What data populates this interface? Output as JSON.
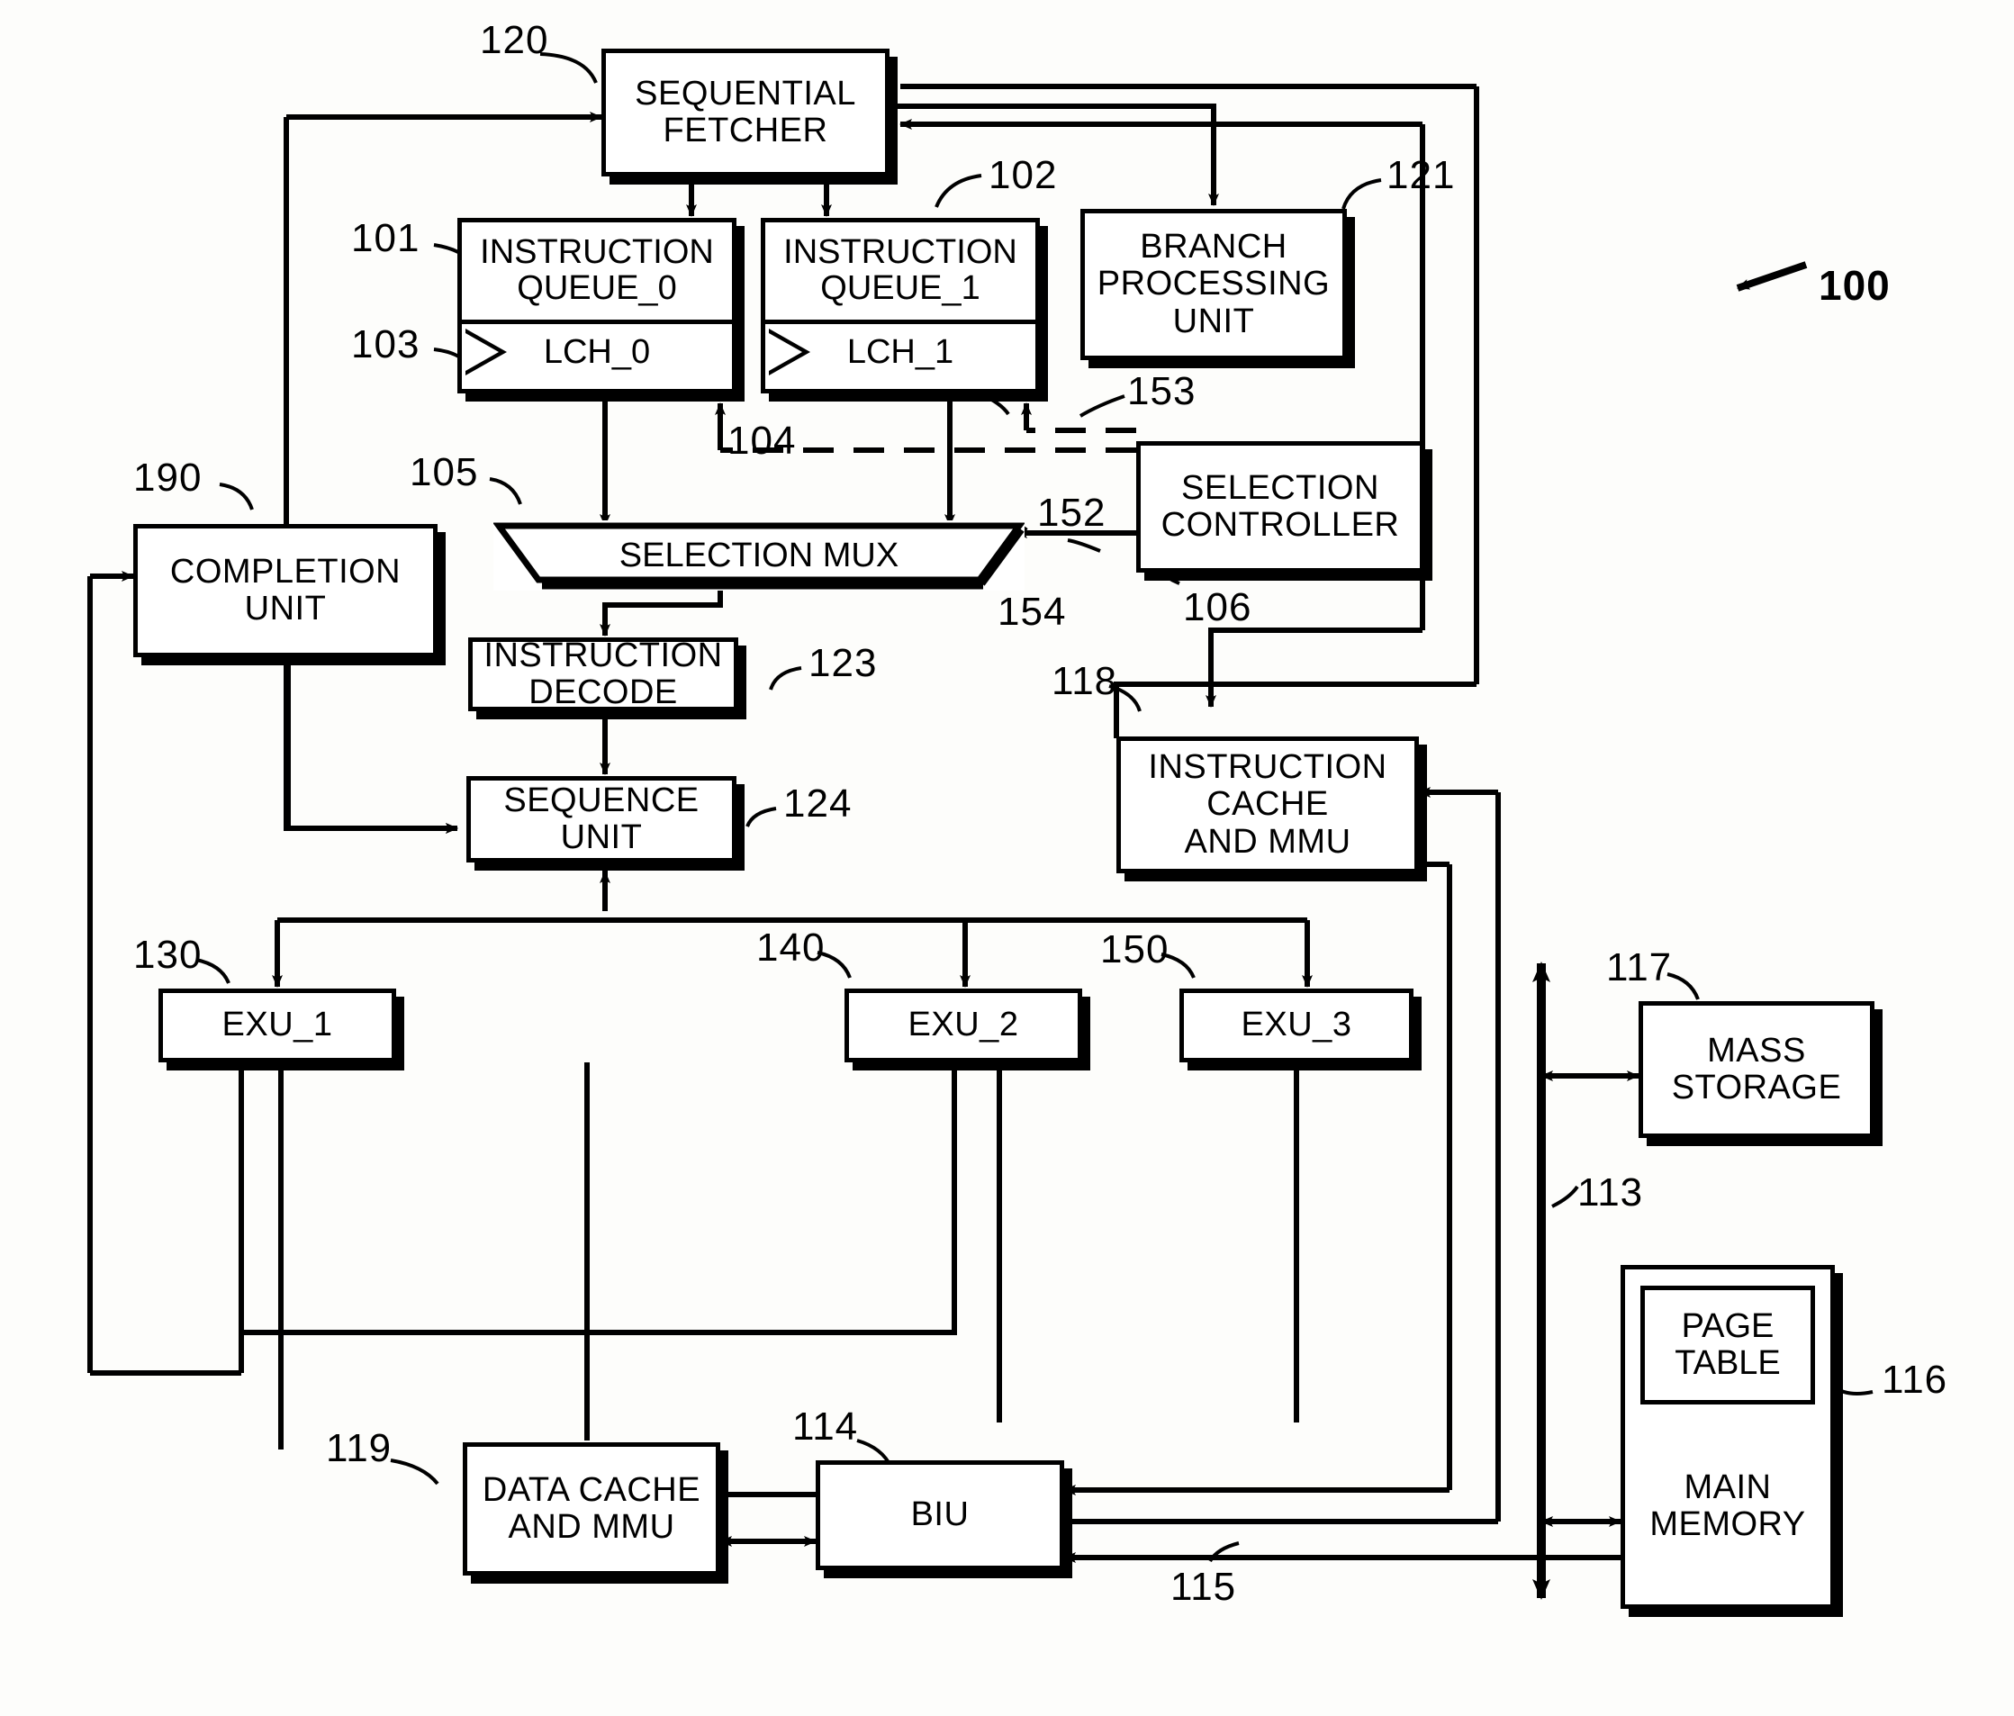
{
  "figure": {
    "system_ref": "100",
    "blocks": [
      {
        "id": "sequential_fetcher",
        "label": "SEQUENTIAL\nFETCHER",
        "ref": "120"
      },
      {
        "id": "instruction_queue_0",
        "label": "INSTRUCTION\nQUEUE_0",
        "ref": "101",
        "latch": "LCH_0",
        "latch_ref": "103"
      },
      {
        "id": "instruction_queue_1",
        "label": "INSTRUCTION\nQUEUE_1",
        "ref": "102",
        "latch": "LCH_1",
        "latch_ref": "104"
      },
      {
        "id": "branch_processing_unit",
        "label": "BRANCH\nPROCESSING\nUNIT",
        "ref": "121"
      },
      {
        "id": "selection_mux",
        "label": "SELECTION MUX",
        "ref": "105"
      },
      {
        "id": "selection_controller",
        "label": "SELECTION\nCONTROLLER",
        "ref": "106"
      },
      {
        "id": "completion_unit",
        "label": "COMPLETION\nUNIT",
        "ref": "190"
      },
      {
        "id": "instruction_decode",
        "label": "INSTRUCTION\nDECODE",
        "ref": "123"
      },
      {
        "id": "sequence_unit",
        "label": "SEQUENCE\nUNIT",
        "ref": "124"
      },
      {
        "id": "instruction_cache_mmu",
        "label": "INSTRUCTION\nCACHE\nAND MMU",
        "ref": "118"
      },
      {
        "id": "exu_1",
        "label": "EXU_1",
        "ref": "130"
      },
      {
        "id": "exu_2",
        "label": "EXU_2",
        "ref": "140"
      },
      {
        "id": "exu_3",
        "label": "EXU_3",
        "ref": "150"
      },
      {
        "id": "mass_storage",
        "label": "MASS\nSTORAGE",
        "ref": "117"
      },
      {
        "id": "main_memory",
        "label": "MAIN\nMEMORY",
        "ref": "116"
      },
      {
        "id": "page_table",
        "label": "PAGE\nTABLE",
        "ref": ""
      },
      {
        "id": "data_cache_mmu",
        "label": "DATA CACHE\nAND MMU",
        "ref": "119"
      },
      {
        "id": "biu",
        "label": "BIU",
        "ref": "114"
      }
    ],
    "signal_refs": [
      {
        "id": "ctrl_line_153",
        "ref": "153"
      },
      {
        "id": "ctrl_line_152",
        "ref": "152"
      },
      {
        "id": "ctrl_line_154",
        "ref": "154"
      },
      {
        "id": "system_bus_113",
        "ref": "113"
      },
      {
        "id": "bus_line_115",
        "ref": "115"
      }
    ],
    "labels": {
      "b120": "120",
      "b101": "101",
      "b102": "102",
      "b103": "103",
      "b104": "104",
      "b121": "121",
      "b105": "105",
      "b106": "106",
      "b152": "152",
      "b153": "153",
      "b154": "154",
      "b190": "190",
      "b123": "123",
      "b124": "124",
      "b118": "118",
      "b130": "130",
      "b140": "140",
      "b150": "150",
      "b117": "117",
      "b113": "113",
      "b116": "116",
      "b119": "119",
      "b114": "114",
      "b115": "115",
      "b100": "100"
    },
    "text": {
      "sequential_fetcher": "SEQUENTIAL\nFETCHER",
      "instruction_queue_0": "INSTRUCTION\nQUEUE_0",
      "instruction_queue_1": "INSTRUCTION\nQUEUE_1",
      "lch_0": "LCH_0",
      "lch_1": "LCH_1",
      "branch_processing_unit": "BRANCH\nPROCESSING\nUNIT",
      "selection_mux": "SELECTION MUX",
      "selection_controller": "SELECTION\nCONTROLLER",
      "completion_unit": "COMPLETION\nUNIT",
      "instruction_decode": "INSTRUCTION\nDECODE",
      "sequence_unit": "SEQUENCE\nUNIT",
      "instruction_cache_mmu": "INSTRUCTION\nCACHE\nAND MMU",
      "exu_1": "EXU_1",
      "exu_2": "EXU_2",
      "exu_3": "EXU_3",
      "mass_storage": "MASS\nSTORAGE",
      "page_table": "PAGE\nTABLE",
      "main_memory": "MAIN\nMEMORY",
      "data_cache_mmu": "DATA CACHE\nAND MMU",
      "biu": "BIU"
    }
  }
}
